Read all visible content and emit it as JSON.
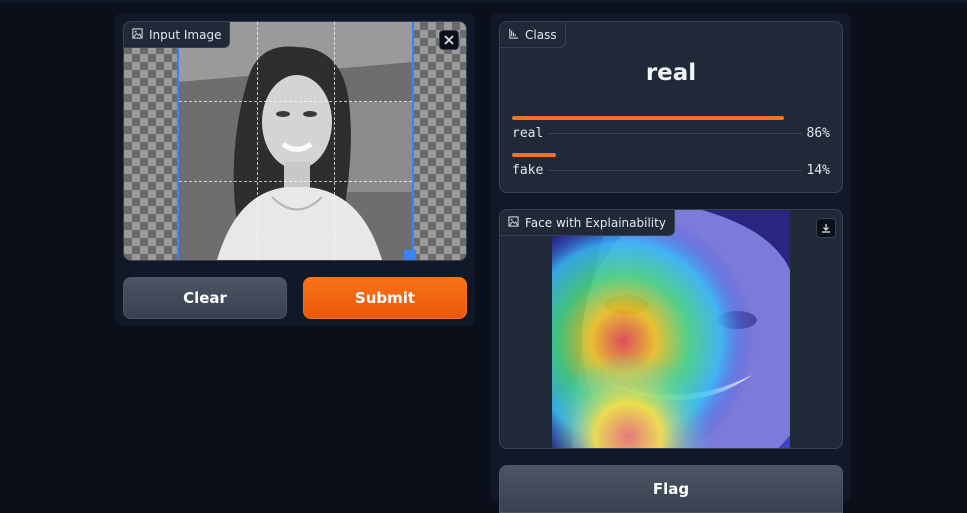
{
  "input": {
    "label": "Input Image",
    "clear_label": "Clear",
    "submit_label": "Submit"
  },
  "classification": {
    "label": "Class",
    "top_class": "real",
    "confidences": [
      {
        "label": "real",
        "value_text": "86%",
        "fraction": 0.86
      },
      {
        "label": "fake",
        "value_text": "14%",
        "fraction": 0.14
      }
    ]
  },
  "explainability": {
    "label": "Face with Explainability"
  },
  "flag_label": "Flag",
  "colors": {
    "background": "#0b0f19",
    "panel": "#111827",
    "block": "#1f2937",
    "accent": "#f97316",
    "selection": "#3b82f6"
  },
  "icons": [
    "image-icon",
    "close-icon",
    "bar-chart-icon",
    "download-icon"
  ]
}
